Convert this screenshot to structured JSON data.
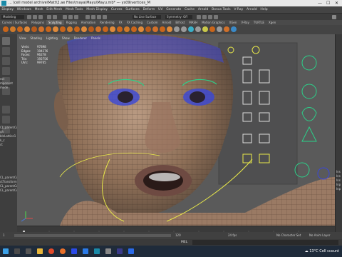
{
  "window": {
    "title": "... \\cell model archive\\Matt\\2.ae Files\\maya\\Mayu\\Mayu.mb* --- ys09\\vertices_M",
    "controls": [
      "—",
      "☐",
      "✕"
    ]
  },
  "menu": [
    "Display",
    "Windows",
    "Mesh",
    "Edit Mesh",
    "Mesh Tools",
    "Mesh Display",
    "Curves",
    "Surfaces",
    "Deform",
    "UV",
    "Generate",
    "Cache",
    "Arnold",
    "Bonus Tools",
    "V-Ray",
    "Arnold",
    "Help"
  ],
  "statusline": {
    "mode": "Modeling",
    "object_field": "No Live Surface",
    "symmetry": "Symmetry: Off"
  },
  "shelf_tabs": [
    "Curves / Surfaces",
    "Polygons",
    "Sculpting",
    "Rigging",
    "Animation",
    "Rendering",
    "FX",
    "FX Caching",
    "Custom",
    "Arnold",
    "Bifrost",
    "MASH",
    "Motion Graphics",
    "XGen",
    "V-Ray",
    "TURTLE",
    "Xgen"
  ],
  "active_shelf_tab": "Sculpting",
  "viewport": {
    "menu": [
      "View",
      "Shading",
      "Lighting",
      "Show",
      "Renderer",
      "Panels"
    ],
    "camera_label": "persp",
    "hud": [
      {
        "label": "Verts:",
        "value": "97898"
      },
      {
        "label": "Edges:",
        "value": "194176"
      },
      {
        "label": "Faces:",
        "value": "96278"
      },
      {
        "label": "Tris:",
        "value": "192756"
      },
      {
        "label": "UVs:",
        "value": "99765"
      }
    ]
  },
  "left_partial_labels": [
    "ect",
    "mponent",
    "mode",
    "CL_parentCo",
    "gh",
    "bleLattice1",
    "k_c",
    "ct",
    "CL_parentCon",
    "ctTransform",
    "CL_parentCon",
    "CL_parentCon"
  ],
  "right_partial_labels": [
    "Ins",
    "Ins",
    "Ins",
    "Inp",
    "Inp"
  ],
  "range": {
    "start": "1",
    "end": "120",
    "fps": "24 fps",
    "character_set": "No Character Set",
    "anim_layer": "No Anim Layer"
  },
  "command_line": {
    "lang": "MEL"
  },
  "taskbar": {
    "weather": "13°C",
    "weather_text": "Cell ccount"
  },
  "colors": {
    "maya_bg": "#444444",
    "viewport_bg": "#5a5a5a",
    "taskbar": "#1f2b3a",
    "wire_blue": "#3a47d8",
    "wire_yellow": "#e8e84a",
    "skin": "#a88770"
  }
}
